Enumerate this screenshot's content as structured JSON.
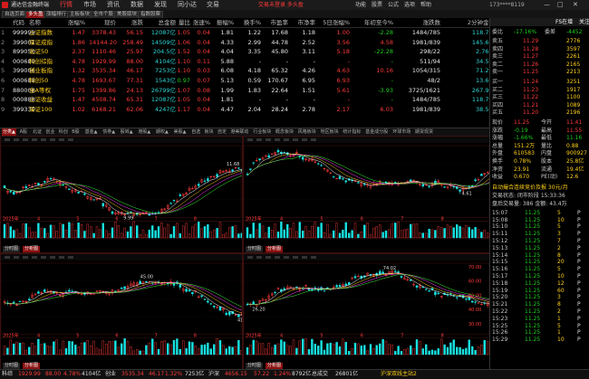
{
  "titlebar": {
    "app_name": "通达信金融终端",
    "menus": [
      "行情",
      "市场",
      "资讯",
      "数据",
      "发现",
      "同小达",
      "交易"
    ],
    "center": "交易未登录 多头盈",
    "right": [
      "功能",
      "股票",
      "公式",
      "选项",
      "帮助"
    ],
    "search": "173****8119"
  },
  "tabs": [
    "自选页面",
    "多头盈",
    "涨幅排行",
    "主板板块",
    "全市个股",
    "美股版块",
    "指数股票"
  ],
  "table": {
    "headers": [
      "代码",
      "名称",
      "涨幅%",
      "现价",
      "涨跌",
      "总金额",
      "量比",
      "涨速%",
      "振幅%",
      "换手%",
      "市盈率",
      "市净率",
      "5日涨幅%",
      "年初至今%",
      "涨跌数",
      "2分钟金额"
    ],
    "rows": [
      {
        "n": "1",
        "code": "999999",
        "name": "上证指数",
        "chg": "1.47",
        "price": "3378.43",
        "diff": "56.15",
        "amount": "12087亿",
        "vol_ratio": "1.05",
        "speed": "0.04",
        "amp": "1.81",
        "turn": "1.22",
        "pe": "17.68",
        "pb": "1.18",
        "d5": "1.00",
        "ytd": "-2.28",
        "updown": "1484/785",
        "m2": "118.7亿",
        "c": "r"
      },
      {
        "n": "2",
        "code": "399001",
        "name": "深证成指",
        "chg": "1.86",
        "price": "14144.20",
        "diff": "258.49",
        "amount": "14509亿",
        "vol_ratio": "1.06",
        "speed": "0.04",
        "amp": "4.33",
        "turn": "2.99",
        "pe": "44.78",
        "pb": "2.52",
        "d5": "3.56",
        "ytd": "4.58",
        "updown": "1981/839",
        "m2": "145.6亿",
        "c": "r"
      },
      {
        "n": "3",
        "code": "899050",
        "name": "北证50",
        "chg": "2.37",
        "price": "1110.46",
        "diff": "25.97",
        "amount": "204.5亿",
        "vol_ratio": "1.52",
        "speed": "0.04",
        "amp": "4.04",
        "turn": "3.35",
        "pe": "45.80",
        "pb": "3.11",
        "d5": "5.18",
        "ytd": "-22.28",
        "updown": "298/22",
        "m2": "2.76亿",
        "c": "r"
      },
      {
        "n": "4",
        "code": "000680",
        "name": "科创综指",
        "chg": "4.78",
        "price": "1929.99",
        "diff": "88.00",
        "amount": "4104亿",
        "vol_ratio": "1.10",
        "speed": "0.11",
        "amp": "5.88",
        "turn": "-",
        "pe": "-",
        "pb": "-",
        "d5": "-",
        "ytd": "-",
        "updown": "511/94",
        "m2": "34.5亿",
        "c": "r"
      },
      {
        "n": "5",
        "code": "399006",
        "name": "创业板指",
        "chg": "1.32",
        "price": "3535.34",
        "diff": "46.17",
        "amount": "7253亿",
        "vol_ratio": "1.10",
        "speed": "0.03",
        "amp": "6.08",
        "turn": "4.18",
        "pe": "65.32",
        "pb": "4.26",
        "d5": "4.63",
        "ytd": "10.16",
        "updown": "1054/315",
        "m2": "71.2亿",
        "c": "r"
      },
      {
        "n": "6",
        "code": "000688",
        "name": "科创50",
        "chg": "4.78",
        "price": "1693.67",
        "diff": "77.31",
        "amount": "1543亿",
        "vol_ratio": "0.97",
        "speed": "0.07",
        "amp": "5.13",
        "turn": "0.59",
        "pe": "170.67",
        "pb": "6.95",
        "d5": "6.93",
        "ytd": "-",
        "updown": "48/2",
        "m2": "13.6亿",
        "c": "r"
      },
      {
        "n": "7",
        "code": "880008",
        "name": "全A等权",
        "chg": "1.75",
        "price": "1399.86",
        "diff": "24.13",
        "amount": "26799亿",
        "vol_ratio": "1.07",
        "speed": "0.08",
        "amp": "1.99",
        "turn": "1.83",
        "pe": "22.64",
        "pb": "1.51",
        "d5": "5.61",
        "ytd": "-3.93",
        "updown": "3725/1621",
        "m2": "267.9亿",
        "c": "r"
      },
      {
        "n": "8",
        "code": "000888",
        "name": "上证收益",
        "chg": "1.47",
        "price": "4508.74",
        "diff": "65.31",
        "amount": "12087亿",
        "vol_ratio": "1.05",
        "speed": "0.04",
        "amp": "1.81",
        "turn": "-",
        "pe": "-",
        "pb": "-",
        "d5": "-",
        "ytd": "-",
        "updown": "1484/785",
        "m2": "118.7亿",
        "c": "r"
      },
      {
        "n": "9",
        "code": "399330",
        "name": "深证100",
        "chg": "1.02",
        "price": "6168.21",
        "diff": "62.06",
        "amount": "4247亿",
        "vol_ratio": "1.17",
        "speed": "0.04",
        "amp": "4.47",
        "turn": "2.04",
        "pe": "28.24",
        "pb": "2.78",
        "d5": "2.17",
        "ytd": "6.03",
        "updown": "1981/839",
        "m2": "38.5亿",
        "c": "r"
      }
    ]
  },
  "midbar": [
    "分类▲",
    "A股",
    "北证",
    "创业",
    "科创",
    "B股",
    "基金▲",
    "债券▲",
    "股转▲",
    "港股▲",
    "期权▲",
    "美股▲",
    "自选",
    "板块",
    "自定",
    "港美联动",
    "行业板块",
    "概念板块",
    "风格板块",
    "地区板块",
    "统计指标",
    "基金成分股",
    "环球市场",
    "期货现货"
  ],
  "charts": {
    "tl": {
      "max_label": "11.68",
      "min_label": "9.99",
      "year": "2025年",
      "xticks": [
        "4",
        "5",
        "6",
        "7",
        "8"
      ],
      "tab1": "分时图",
      "tab2": "分析图"
    },
    "tr": {
      "min_label": "4.61",
      "year": "2025年",
      "xticks": [
        "4",
        "5",
        "6",
        "7",
        "8"
      ],
      "tab1": "分时图",
      "tab2": "分析图"
    },
    "bl": {
      "max_label": "45.00",
      "min_label": "41.80",
      "year": "2025年",
      "xticks": [
        "4",
        "5",
        "6",
        "7",
        "8"
      ],
      "tab1": "分时图",
      "tab2": "分析图"
    },
    "br": {
      "max_label": "74.02",
      "min_label": "26.20",
      "year": "2025年",
      "xticks": [
        "4",
        "5",
        "6",
        "7",
        "8"
      ],
      "tab1": "分时图",
      "tab2": "分析图",
      "yticks": [
        "70.00",
        "60.00",
        "50.00",
        "40.00",
        "30.00"
      ]
    }
  },
  "rightp": {
    "title": "FS在增",
    "fav_label": "关注",
    "ratio_row": [
      "委比",
      "-17.16%",
      "委差",
      "-4452"
    ],
    "asks": [
      {
        "l": "卖五",
        "p": "11.29",
        "v": "2776"
      },
      {
        "l": "卖四",
        "p": "11.28",
        "v": "3597"
      },
      {
        "l": "卖三",
        "p": "11.27",
        "v": "2261"
      },
      {
        "l": "卖二",
        "p": "11.26",
        "v": "2165"
      },
      {
        "l": "卖一",
        "p": "11.25",
        "v": "2213"
      }
    ],
    "bids": [
      {
        "l": "买一",
        "p": "11.24",
        "v": "3251"
      },
      {
        "l": "买二",
        "p": "11.23",
        "v": "1917"
      },
      {
        "l": "买三",
        "p": "11.22",
        "v": "1100"
      },
      {
        "l": "买四",
        "p": "11.21",
        "v": "1089"
      },
      {
        "l": "买五",
        "p": "11.20",
        "v": "2196"
      }
    ],
    "stats": [
      [
        "现价",
        "11.25",
        "今开",
        "11.41"
      ],
      [
        "涨跌",
        "-0.19",
        "最高",
        "11.55"
      ],
      [
        "涨幅",
        "-1.66%",
        "最低",
        "11.16"
      ],
      [
        "总量",
        "151.2万",
        "量比",
        "0.88"
      ],
      [
        "外盘",
        "610583",
        "内盘",
        "900927"
      ],
      [
        "换手",
        "0.78%",
        "股本",
        "25.8亿"
      ],
      [
        "净资",
        "23.91",
        "流通",
        "19.4亿"
      ],
      [
        "收益",
        "0.670",
        "PE(动)",
        "12.6"
      ]
    ],
    "notice1": "自动撮合连续竞价及报  30元/月",
    "notice2": "交易状态: 闭市阶段 15:33:36",
    "notice3": "盘后交易量: 386  金额: 43.4万",
    "ticks": [
      {
        "t": "15:07",
        "p": "11.25",
        "v": "5",
        "d": "P"
      },
      {
        "t": "15:08",
        "p": "11.25",
        "v": "10",
        "d": "P"
      },
      {
        "t": "15:10",
        "p": "11.25",
        "v": "5",
        "d": "P"
      },
      {
        "t": "15:11",
        "p": "11.25",
        "v": "3",
        "d": "P"
      },
      {
        "t": "15:12",
        "p": "11.25",
        "v": "7",
        "d": "P"
      },
      {
        "t": "15:13",
        "p": "11.25",
        "v": "2",
        "d": "P"
      },
      {
        "t": "15:14",
        "p": "11.25",
        "v": "8",
        "d": "P"
      },
      {
        "t": "15:15",
        "p": "11.25",
        "v": "20",
        "d": "P"
      },
      {
        "t": "15:16",
        "p": "11.25",
        "v": "5",
        "d": "P"
      },
      {
        "t": "15:17",
        "p": "11.25",
        "v": "10",
        "d": "P"
      },
      {
        "t": "15:18",
        "p": "11.25",
        "v": "12",
        "d": "P"
      },
      {
        "t": "15:19",
        "p": "11.25",
        "v": "60",
        "d": "P"
      },
      {
        "t": "15:20",
        "p": "11.25",
        "v": "3",
        "d": "P"
      },
      {
        "t": "15:21",
        "p": "11.25",
        "v": "8",
        "d": "P"
      },
      {
        "t": "15:22",
        "p": "11.25",
        "v": "2",
        "d": "P"
      },
      {
        "t": "15:23",
        "p": "11.25",
        "v": "1",
        "d": "P"
      },
      {
        "t": "15:25",
        "p": "11.25",
        "v": "5",
        "d": "P"
      },
      {
        "t": "15:26",
        "p": "11.25",
        "v": "1",
        "d": "P"
      },
      {
        "t": "15:29",
        "p": "11.25",
        "v": "10",
        "d": "P"
      }
    ]
  },
  "status": {
    "items": [
      "科综",
      "1929.99",
      "88.00",
      "4.78%",
      "4104亿",
      "创业",
      "3535.34",
      "46.17",
      "1.32%",
      "7253亿",
      "沪深",
      "4656.15",
      "57.22",
      "1.24%",
      "8792亿",
      "总成交",
      "26801亿",
      "沪深双线主站2"
    ]
  },
  "colors": {
    "up": "#ff3b3b",
    "down": "#1fd01f",
    "accent": "#8a1010",
    "yellow": "#ffd11a"
  }
}
